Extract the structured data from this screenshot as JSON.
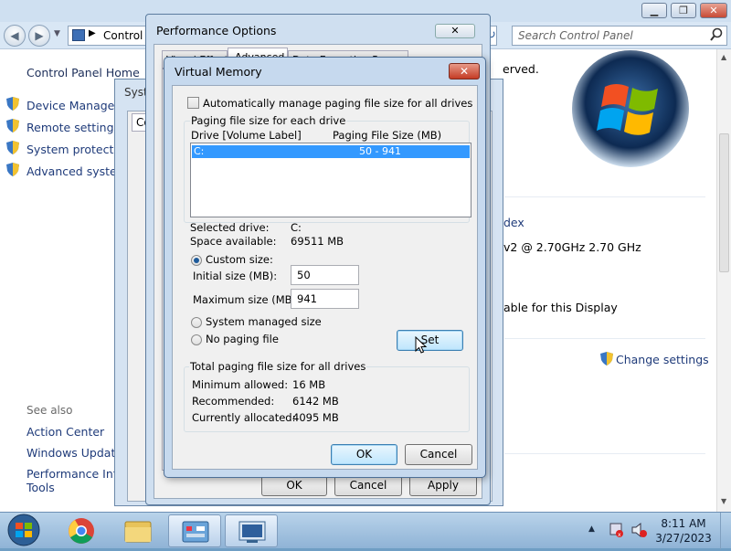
{
  "control_panel": {
    "address": "Control P",
    "search_placeholder": "Search Control Panel",
    "sidebar": {
      "home": "Control Panel Home",
      "links": [
        "Device Manager",
        "Remote settings",
        "System protection",
        "Advanced system"
      ],
      "see_also_heading": "See also",
      "see_also": [
        "Action Center",
        "Windows Update",
        "Performance Infor",
        "Tools"
      ]
    },
    "main": {
      "reserved": "erved.",
      "index": "dex",
      "processor": "v2 @ 2.70GHz   2.70 GHz",
      "display": "able for this Display",
      "change_settings": "Change settings"
    }
  },
  "system_properties": {
    "title_fragment": "Syst",
    "tab_fragment": "Co"
  },
  "performance_options": {
    "title": "Performance Options",
    "tabs": [
      "Visual Effects",
      "Advanced",
      "Data Execution Prevention"
    ],
    "buttons": {
      "ok": "OK",
      "cancel": "Cancel",
      "apply": "Apply"
    }
  },
  "virtual_memory": {
    "title": "Virtual Memory",
    "auto_manage_label": "Automatically manage paging file size for all drives",
    "auto_manage_checked": false,
    "paging_group_label": "Paging file size for each drive",
    "columns": {
      "drive": "Drive  [Volume Label]",
      "size": "Paging File Size (MB)"
    },
    "drives": [
      {
        "drive": "C:",
        "size": "50 - 941",
        "selected": true
      }
    ],
    "selected_drive_label": "Selected drive:",
    "selected_drive_value": "C:",
    "space_available_label": "Space available:",
    "space_available_value": "69511 MB",
    "custom_size_label": "Custom size:",
    "initial_size_label": "Initial size (MB):",
    "initial_size_value": "50",
    "maximum_size_label": "Maximum size (MB):",
    "maximum_size_value": "941",
    "system_managed_label": "System managed size",
    "no_paging_label": "No paging file",
    "set_button": "Set",
    "totals_group_label": "Total paging file size for all drives",
    "minimum_allowed_label": "Minimum allowed:",
    "minimum_allowed_value": "16 MB",
    "recommended_label": "Recommended:",
    "recommended_value": "6142 MB",
    "currently_allocated_label": "Currently allocated:",
    "currently_allocated_value": "4095 MB",
    "ok_button": "OK",
    "cancel_button": "Cancel"
  },
  "taskbar": {
    "time": "8:11 AM",
    "date": "3/27/2023",
    "pinned": [
      "start-orb",
      "chrome-icon",
      "file-explorer-icon",
      "control-panel-icon",
      "system-properties-icon"
    ]
  },
  "colors": {
    "selection": "#3399ff",
    "link": "#1f3b7a",
    "dialog_frame": "#c6d9ee",
    "close_red": "#c43b25"
  }
}
